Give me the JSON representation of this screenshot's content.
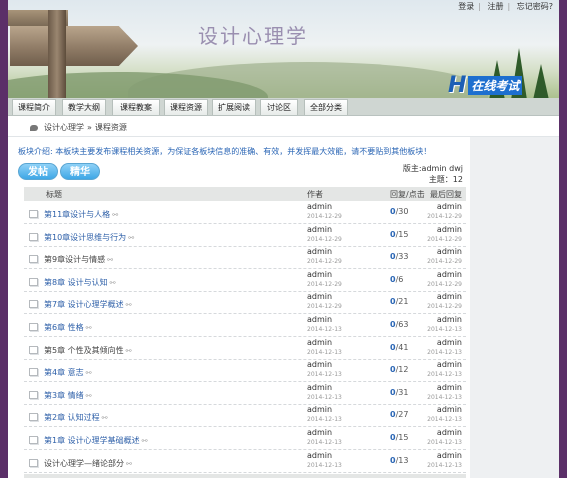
{
  "top_links": [
    "登录",
    "注册",
    "忘记密码?"
  ],
  "site_title": "设计心理学",
  "logo": {
    "letter": "H",
    "text": "在线考试"
  },
  "nav": [
    "课程简介",
    "教学大纲",
    "课程教案",
    "课程资源",
    "扩展阅读",
    "讨论区",
    "全部分类"
  ],
  "breadcrumb": [
    "设计心理学",
    "课程资源"
  ],
  "intro": "板块介绍: 本板块主要发布课程相关资源，为保证各板块信息的准确、有效，并发挥最大效能，请不要贴到其他板块！",
  "buttons": {
    "post": "发帖",
    "essence": "精华"
  },
  "moderator": "版主:admin dwj",
  "topic_count": "主题：12",
  "columns": {
    "title": "标题",
    "author": "作者",
    "replies": "回复/点击",
    "last": "最后回复"
  },
  "rows": [
    {
      "title": "第11章设计与人格",
      "author": "admin",
      "date": "2014-12-29",
      "replies": "0",
      "clicks": "/30",
      "last": "admin",
      "ldate": "2014-12-29",
      "link": true
    },
    {
      "title": "第10章设计思维与行为",
      "author": "admin",
      "date": "2014-12-29",
      "replies": "0",
      "clicks": "/15",
      "last": "admin",
      "ldate": "2014-12-29",
      "link": true
    },
    {
      "title": "第9章设计与情感",
      "author": "admin",
      "date": "2014-12-29",
      "replies": "0",
      "clicks": "/33",
      "last": "admin",
      "ldate": "2014-12-29",
      "link": false
    },
    {
      "title": "第8章 设计与认知",
      "author": "admin",
      "date": "2014-12-29",
      "replies": "0",
      "clicks": "/6",
      "last": "admin",
      "ldate": "2014-12-29",
      "link": true
    },
    {
      "title": "第7章 设计心理学概述",
      "author": "admin",
      "date": "2014-12-29",
      "replies": "0",
      "clicks": "/21",
      "last": "admin",
      "ldate": "2014-12-29",
      "link": true
    },
    {
      "title": "第6章 性格",
      "author": "admin",
      "date": "2014-12-13",
      "replies": "0",
      "clicks": "/63",
      "last": "admin",
      "ldate": "2014-12-13",
      "link": true
    },
    {
      "title": "第5章 个性及其倾向性",
      "author": "admin",
      "date": "2014-12-13",
      "replies": "0",
      "clicks": "/41",
      "last": "admin",
      "ldate": "2014-12-13",
      "link": false
    },
    {
      "title": "第4章 意志",
      "author": "admin",
      "date": "2014-12-13",
      "replies": "0",
      "clicks": "/12",
      "last": "admin",
      "ldate": "2014-12-13",
      "link": true
    },
    {
      "title": "第3章 情绪",
      "author": "admin",
      "date": "2014-12-13",
      "replies": "0",
      "clicks": "/31",
      "last": "admin",
      "ldate": "2014-12-13",
      "link": true
    },
    {
      "title": "第2章 认知过程",
      "author": "admin",
      "date": "2014-12-13",
      "replies": "0",
      "clicks": "/27",
      "last": "admin",
      "ldate": "2014-12-13",
      "link": true
    },
    {
      "title": "第1章 设计心理学基础概述",
      "author": "admin",
      "date": "2014-12-13",
      "replies": "0",
      "clicks": "/15",
      "last": "admin",
      "ldate": "2014-12-13",
      "link": true
    },
    {
      "title": "设计心理学—绪论部分",
      "author": "admin",
      "date": "2014-12-13",
      "replies": "0",
      "clicks": "/13",
      "last": "admin",
      "ldate": "2014-12-13",
      "link": false
    }
  ]
}
